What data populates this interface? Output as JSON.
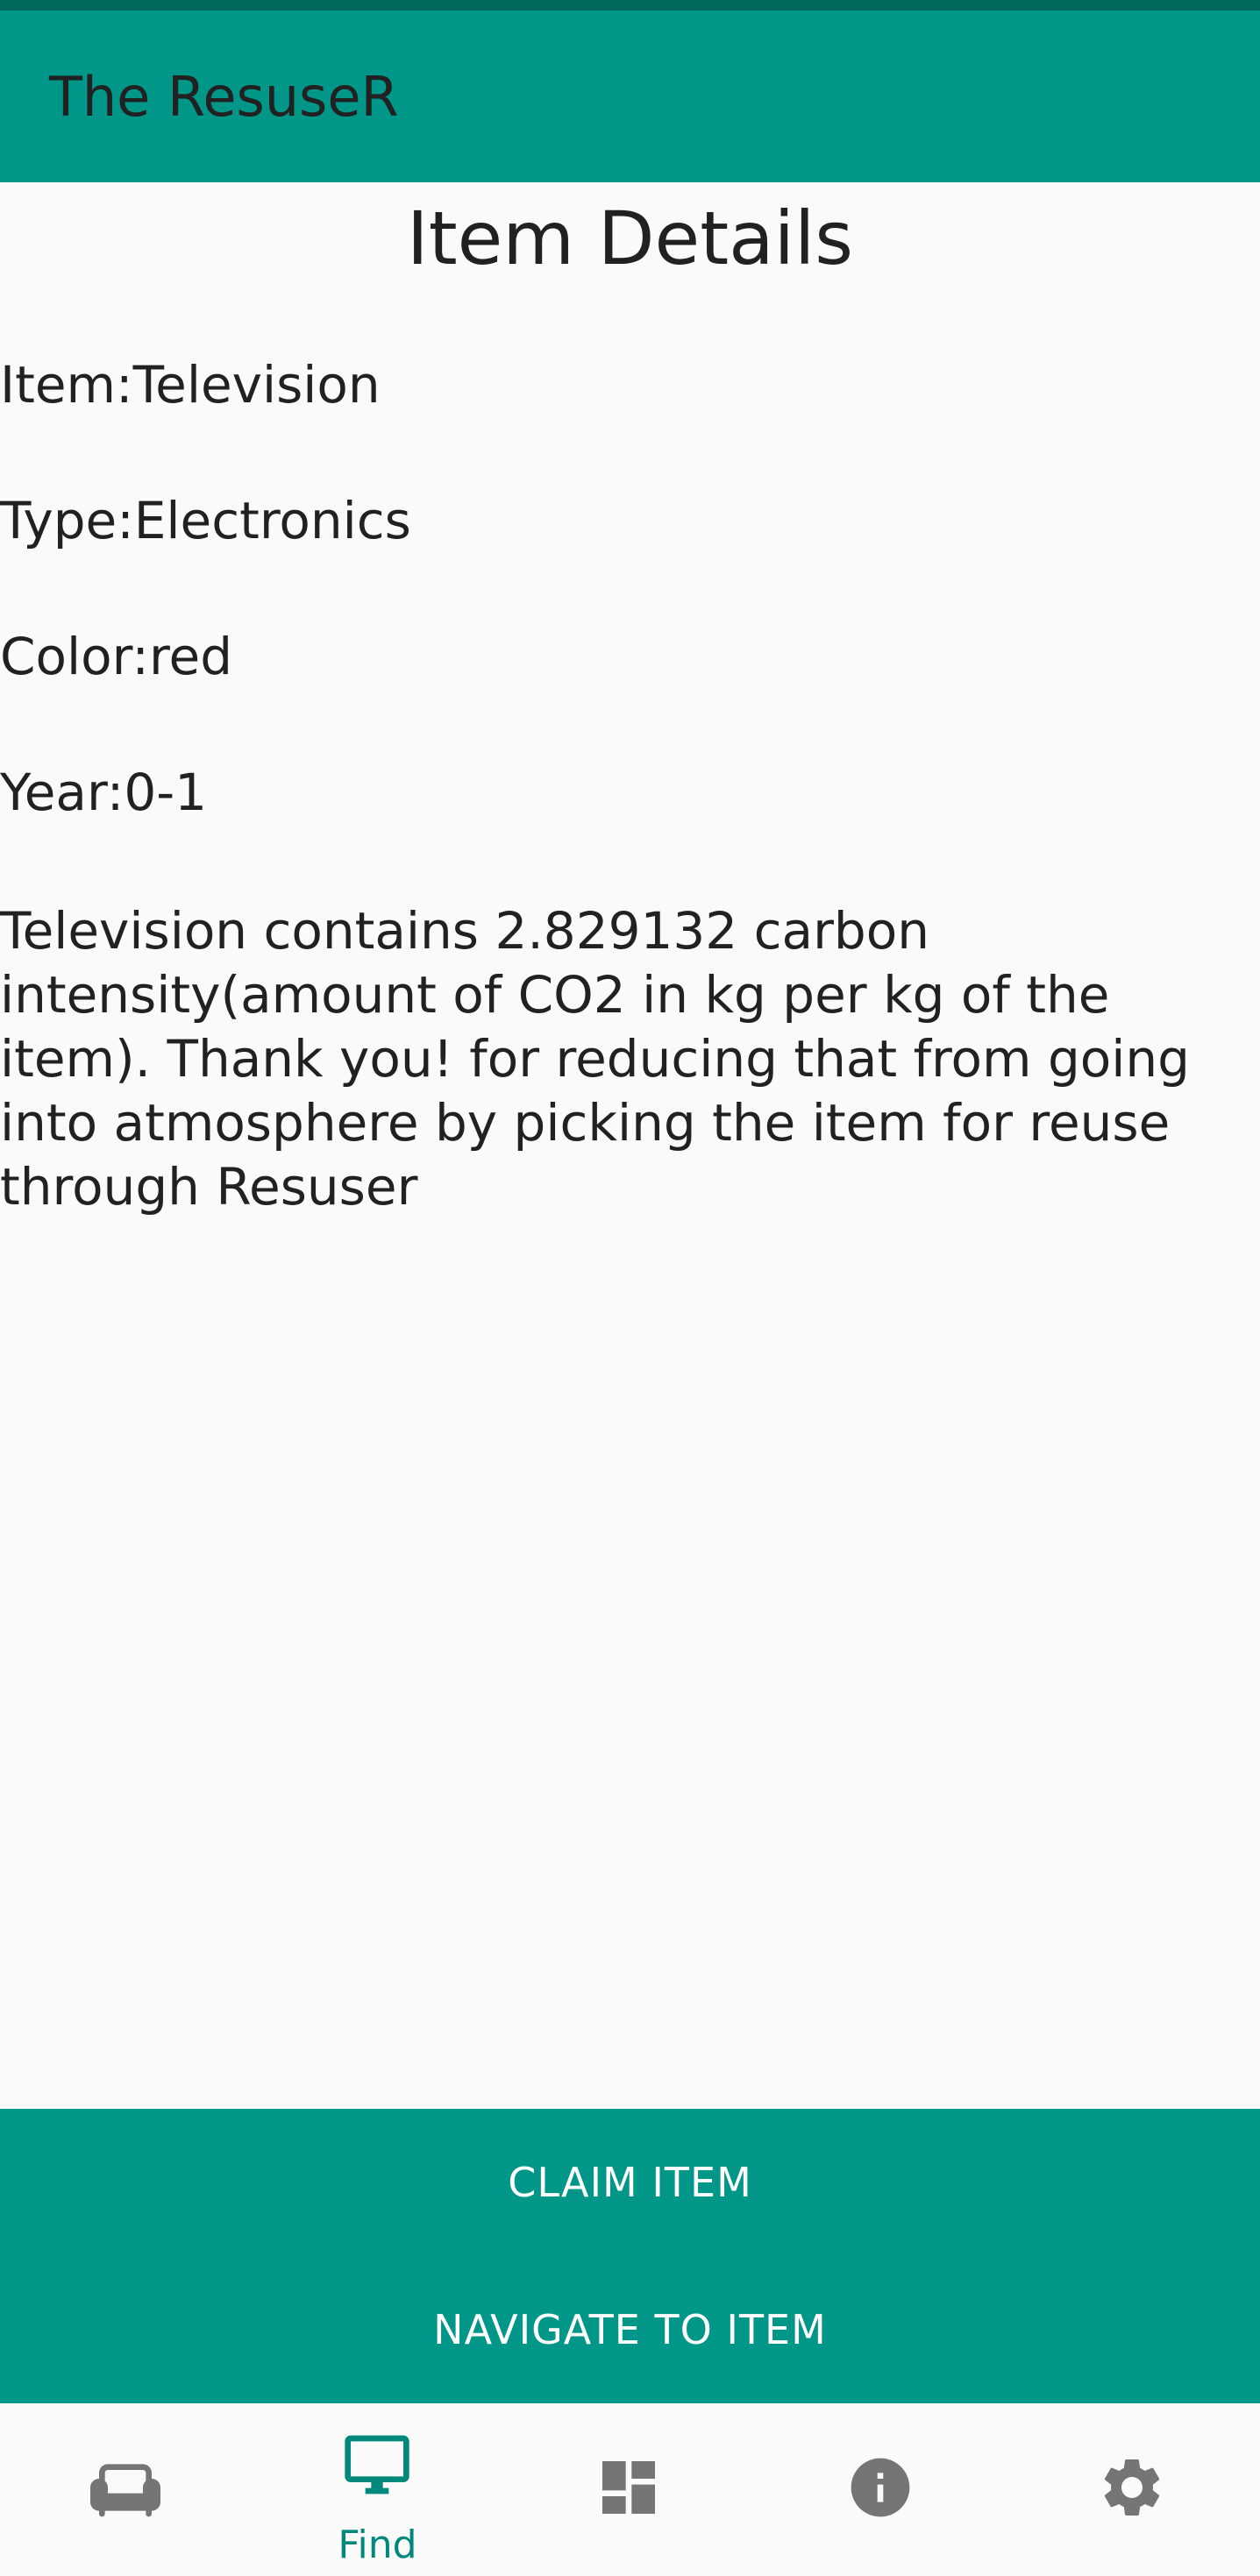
{
  "app": {
    "title": "The ResuseR"
  },
  "page": {
    "heading": "Item Details"
  },
  "details": {
    "item": "Item:Television",
    "type": "Type:Electronics",
    "color": "Color:red",
    "year": "Year:0-1",
    "message": "Television contains 2.829132 carbon intensity(amount of CO2 in kg per kg of the item). Thank you! for reducing that from going into atmosphere by picking the item for reuse through Resuser"
  },
  "actions": {
    "claim_label": "CLAIM ITEM",
    "navigate_label": "NAVIGATE TO ITEM"
  },
  "nav": {
    "items": [
      {
        "icon": "sofa-icon",
        "label": "",
        "active": false
      },
      {
        "icon": "monitor-icon",
        "label": "Find",
        "active": true
      },
      {
        "icon": "dashboard-icon",
        "label": "",
        "active": false
      },
      {
        "icon": "info-icon",
        "label": "",
        "active": false
      },
      {
        "icon": "gear-icon",
        "label": "",
        "active": false
      }
    ]
  },
  "colors": {
    "primary": "#009688",
    "primary_dark": "#00695c",
    "nav_active": "#00897b",
    "nav_inactive": "#757575",
    "background": "#fafafa"
  }
}
